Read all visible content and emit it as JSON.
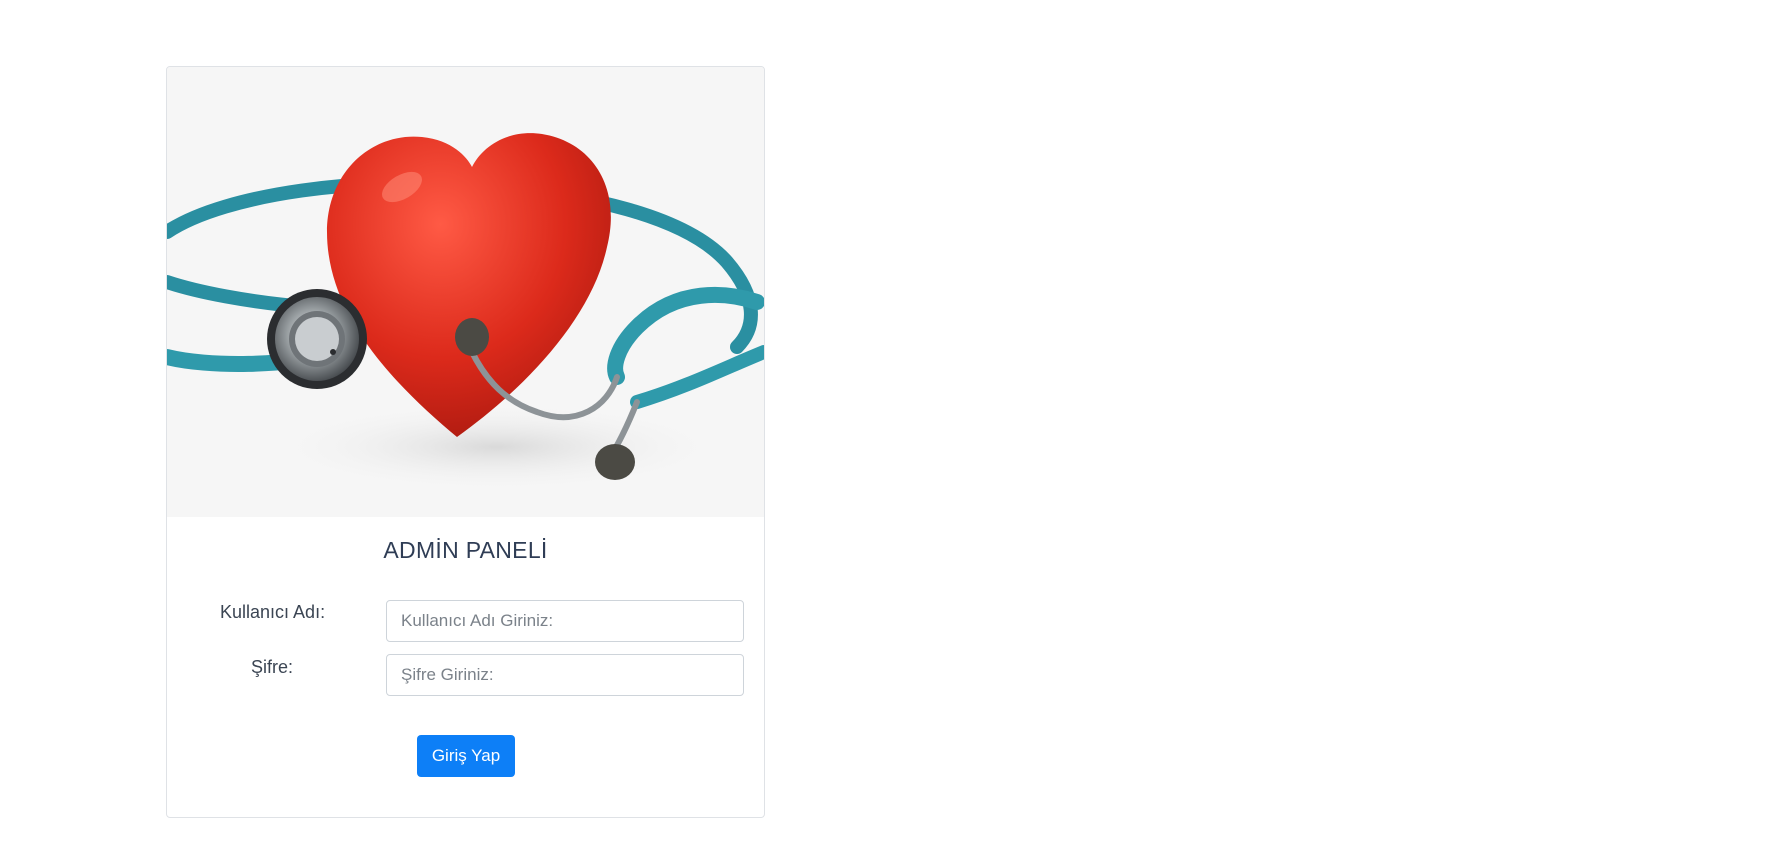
{
  "login": {
    "title": "ADMİN PANELİ",
    "username_label": "Kullanıcı Adı:",
    "username_placeholder": "Kullanıcı Adı Giriniz:",
    "username_value": "",
    "password_label": "Şifre:",
    "password_placeholder": "Şifre Giriniz:",
    "password_value": "",
    "submit_label": "Giriş Yap"
  },
  "colors": {
    "button": "#0d7ff7",
    "title": "#2f3d55",
    "heart": "#d92a1c",
    "stethoscope_tube": "#2f9aab"
  },
  "icons": {
    "hero_image": "heart-stethoscope-image"
  }
}
